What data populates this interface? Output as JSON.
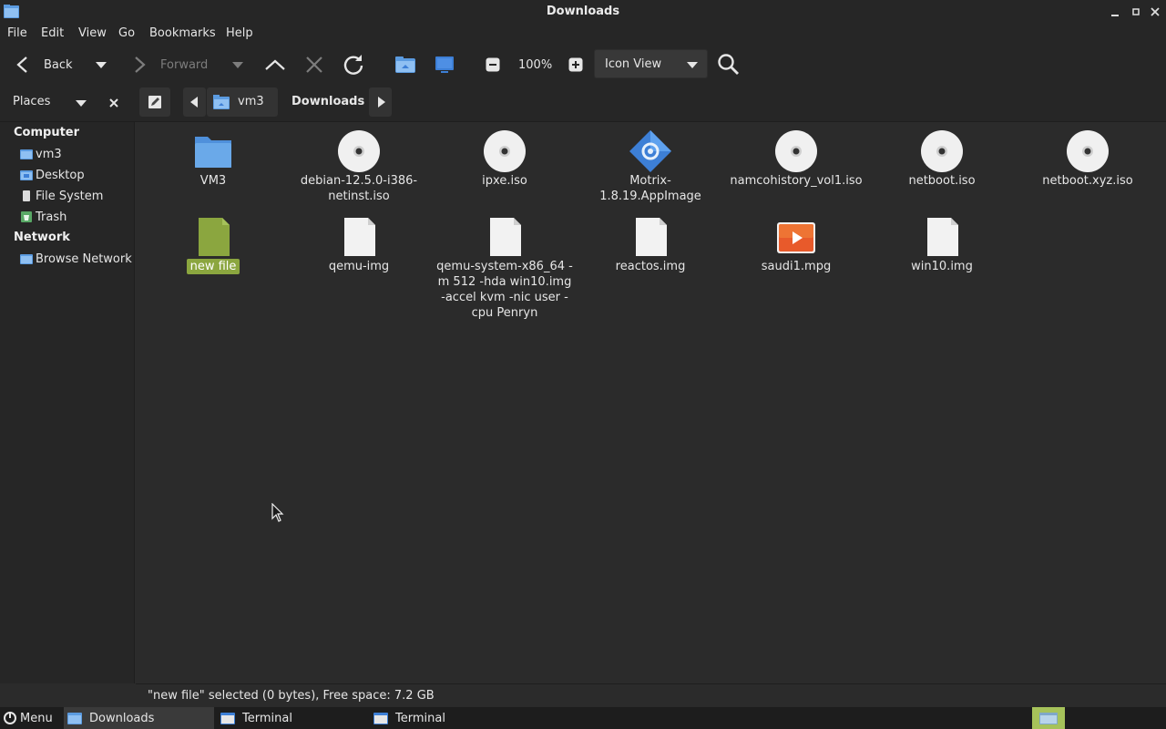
{
  "window": {
    "title": "Downloads"
  },
  "menu": [
    "File",
    "Edit",
    "View",
    "Go",
    "Bookmarks",
    "Help"
  ],
  "toolbar": {
    "back": "Back",
    "forward": "Forward",
    "zoom": "100%",
    "view_mode": "Icon View"
  },
  "location": {
    "places_label": "Places",
    "crumbs": [
      "vm3",
      "Downloads"
    ]
  },
  "sidebar": {
    "computer_header": "Computer",
    "computer_items": [
      "vm3",
      "Desktop",
      "File System",
      "Trash"
    ],
    "network_header": "Network",
    "network_items": [
      "Browse Network"
    ]
  },
  "files": [
    {
      "name": "VM3",
      "type": "folder"
    },
    {
      "name": "debian-12.5.0-i386-netinst.iso",
      "type": "disc"
    },
    {
      "name": "ipxe.iso",
      "type": "disc"
    },
    {
      "name": "Motrix-1.8.19.AppImage",
      "type": "appimage"
    },
    {
      "name": "namcohistory_vol1.iso",
      "type": "disc"
    },
    {
      "name": "netboot.iso",
      "type": "disc"
    },
    {
      "name": "netboot.xyz.iso",
      "type": "disc"
    },
    {
      "name": "new file",
      "type": "file-green",
      "selected": true
    },
    {
      "name": "qemu-img",
      "type": "file"
    },
    {
      "name": "qemu-system-x86_64 -m 512 -hda win10.img -accel kvm -nic user -cpu Penryn",
      "type": "file"
    },
    {
      "name": "reactos.img",
      "type": "file"
    },
    {
      "name": "saudi1.mpg",
      "type": "video"
    },
    {
      "name": "win10.img",
      "type": "file"
    }
  ],
  "status": {
    "text": "\"new file\" selected (0 bytes), Free space: 7.2 GB"
  },
  "taskbar": {
    "menu": "Menu",
    "tasks": [
      "Downloads",
      "Terminal",
      "Terminal"
    ]
  },
  "colors": {
    "selection": "#8ba63f",
    "folder": "#6aa9e9",
    "accent": "#3d7fd6"
  }
}
